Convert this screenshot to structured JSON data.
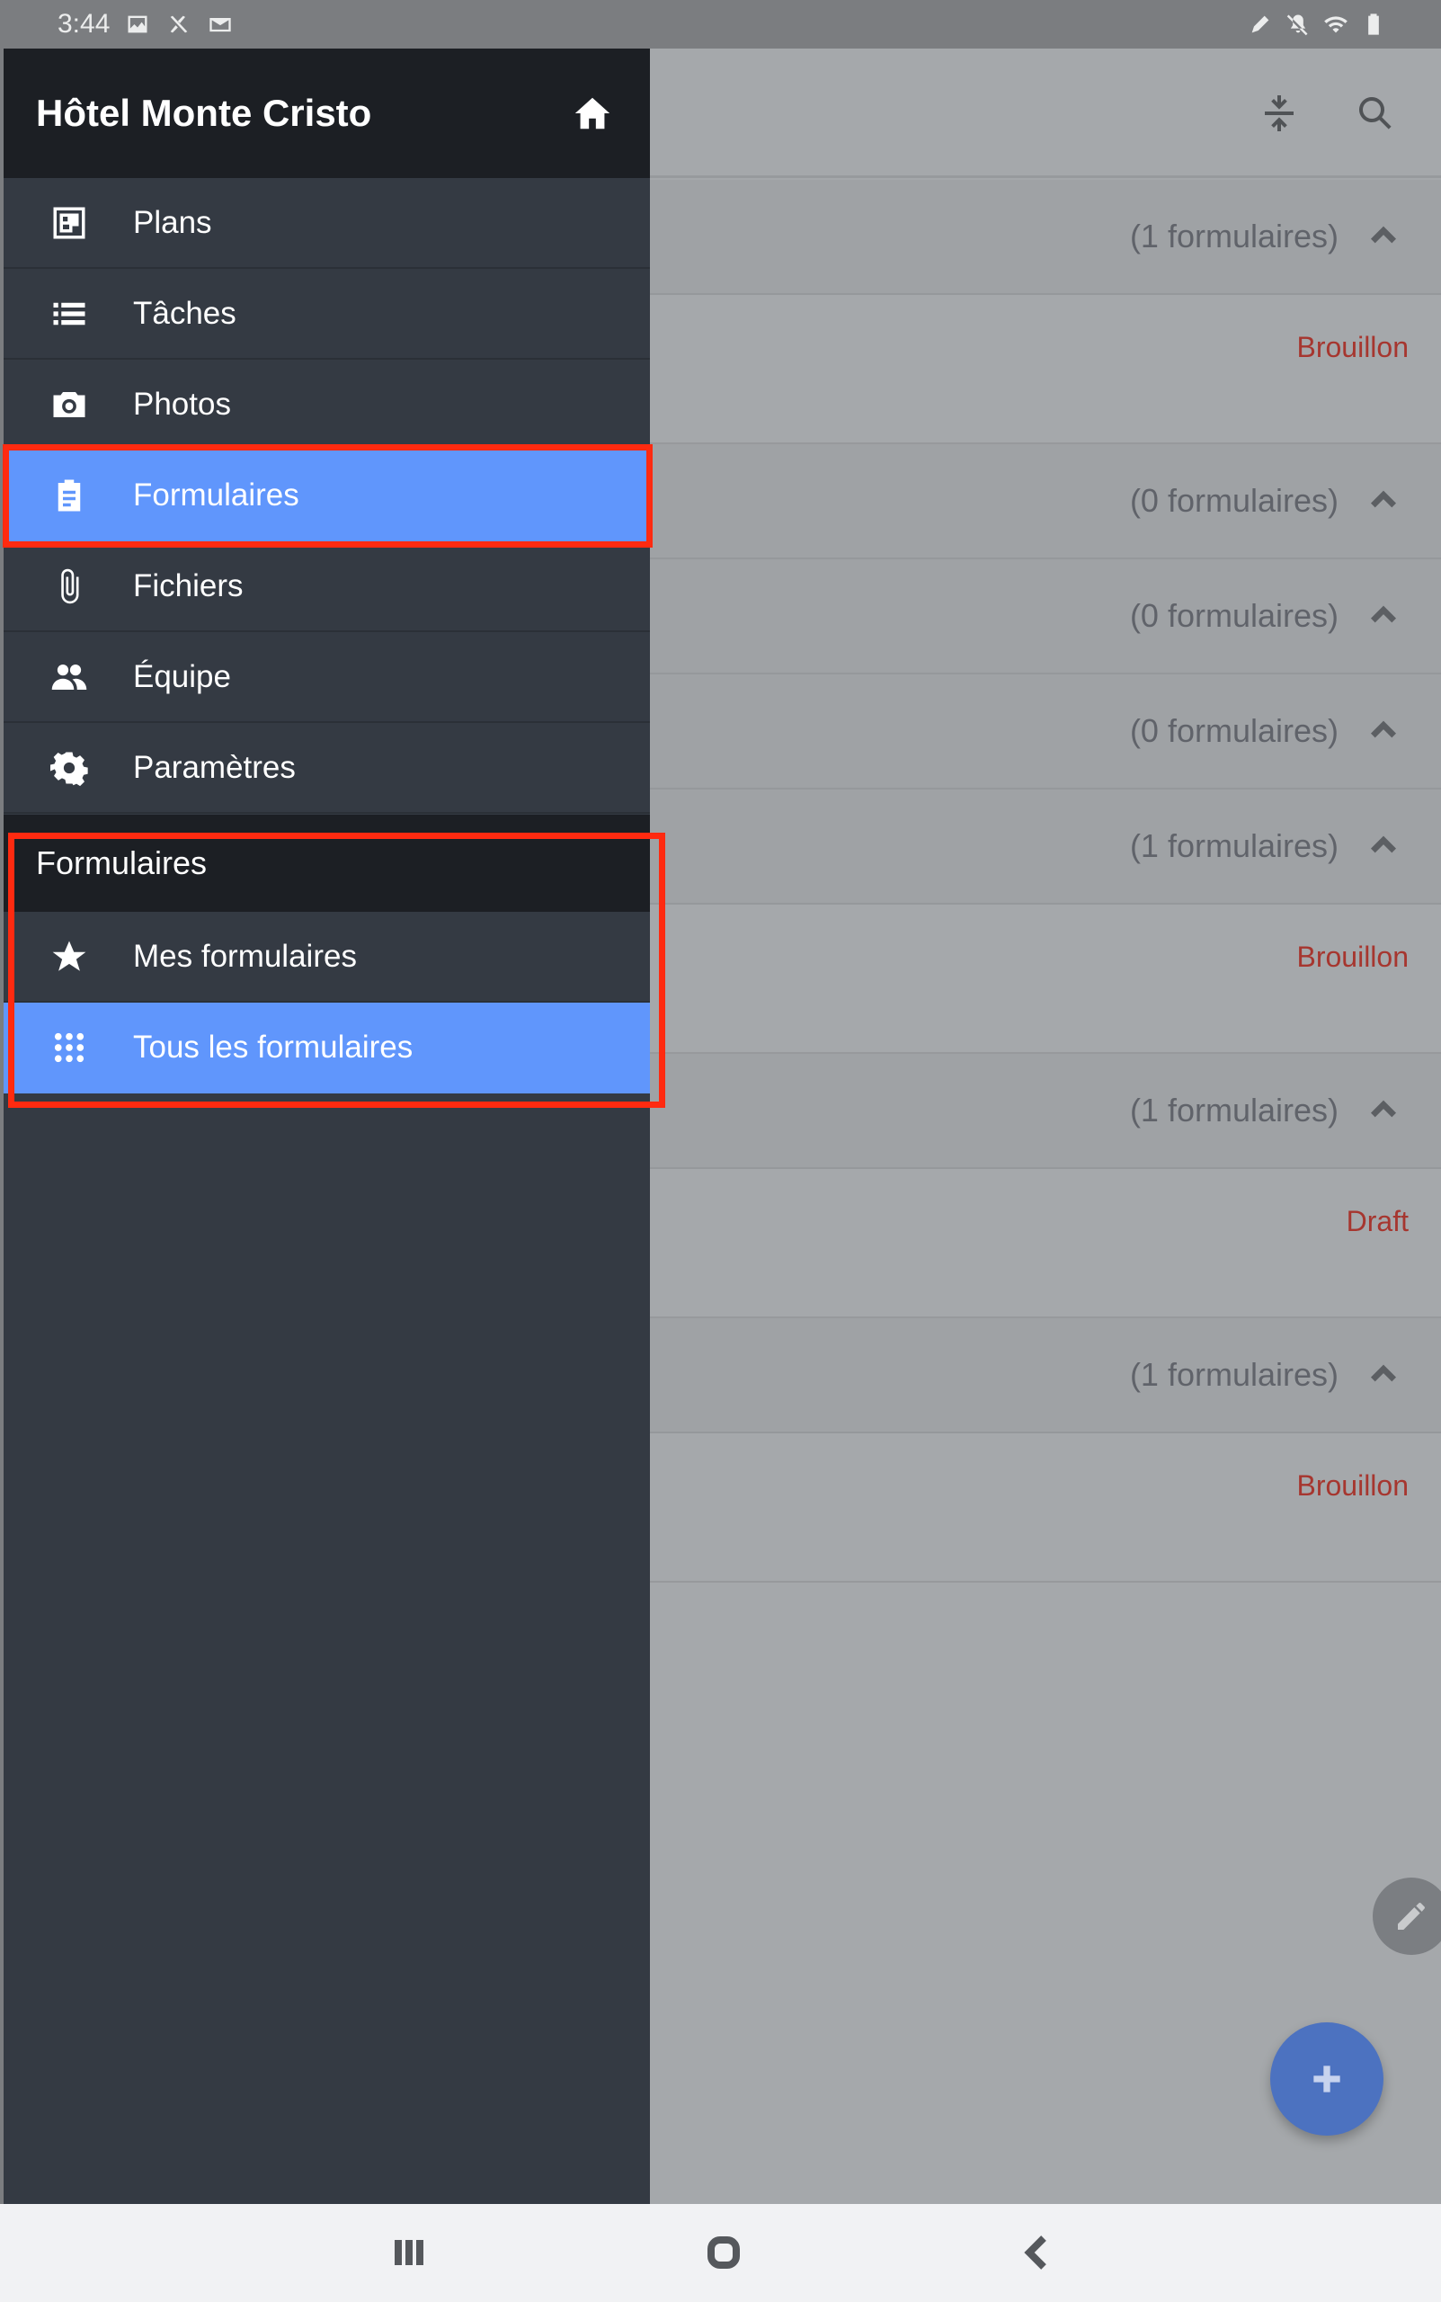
{
  "status_bar": {
    "time": "3:44",
    "left_icons": [
      "image-icon",
      "no-signal-icon",
      "mail-icon"
    ],
    "right_icons": [
      "stylus-icon",
      "mute-icon",
      "wifi-icon",
      "battery-icon"
    ]
  },
  "drawer": {
    "project_title": "Hôtel Monte Cristo",
    "items": [
      {
        "label": "Plans",
        "icon": "plans-icon",
        "active": false
      },
      {
        "label": "Tâches",
        "icon": "list-icon",
        "active": false
      },
      {
        "label": "Photos",
        "icon": "camera-icon",
        "active": false
      },
      {
        "label": "Formulaires",
        "icon": "clipboard-icon",
        "active": true
      },
      {
        "label": "Fichiers",
        "icon": "paperclip-icon",
        "active": false
      },
      {
        "label": "Équipe",
        "icon": "team-icon",
        "active": false
      },
      {
        "label": "Paramètres",
        "icon": "gear-icon",
        "active": false
      }
    ],
    "section": {
      "title": "Formulaires",
      "items": [
        {
          "label": "Mes formulaires",
          "icon": "star-icon",
          "active": false
        },
        {
          "label": "Tous les formulaires",
          "icon": "grid-icon",
          "active": true
        }
      ]
    }
  },
  "main": {
    "header_icons": [
      "compress-icon",
      "search-icon"
    ],
    "groups": [
      {
        "count": "(1 formulaires)",
        "forms": [
          {
            "status": "Brouillon"
          }
        ]
      },
      {
        "count": "(0 formulaires)",
        "forms": []
      },
      {
        "count": "(0 formulaires)",
        "forms": []
      },
      {
        "count": "(0 formulaires)",
        "forms": []
      },
      {
        "count": "(1 formulaires)",
        "forms": [
          {
            "status": "Brouillon"
          }
        ]
      },
      {
        "count": "(1 formulaires)",
        "forms": [
          {
            "status": "Draft"
          }
        ]
      },
      {
        "count": "(1 formulaires)",
        "forms": [
          {
            "status": "Brouillon"
          }
        ]
      }
    ]
  },
  "colors": {
    "drawer_bg": "#343a43",
    "drawer_header_bg": "#1c1f24",
    "active_item_bg": "#6096fc",
    "highlight_red": "#ff2a10",
    "status_red": "#a6362f",
    "fab_blue": "#4c72c0"
  }
}
